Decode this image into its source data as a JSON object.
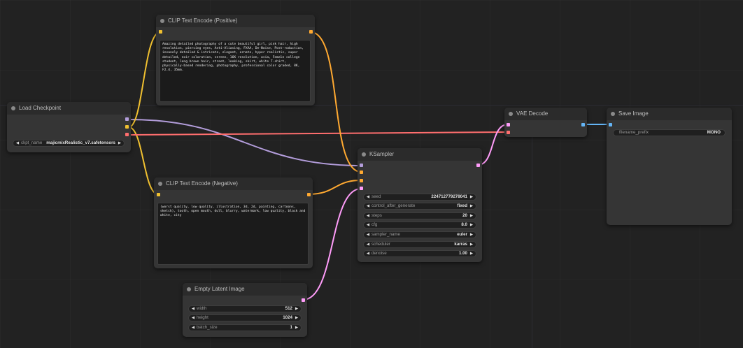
{
  "colors": {
    "background": "#222222",
    "node_body": "#353535",
    "node_title": "#2b2b2b",
    "model_link": "#b39ddb",
    "clip_link": "#f0c030",
    "vae_link": "#ff6e6e",
    "conditioning_link": "#ffa931",
    "latent_link": "#ff9cf9",
    "image_link": "#64b5f6"
  },
  "nodes": {
    "load_checkpoint": {
      "title": "Load Checkpoint",
      "ckpt_name_label": "ckpt_name",
      "ckpt_name_value": "majicmixRealistic_v7.safetensors"
    },
    "clip_positive": {
      "title": "CLIP Text Encode (Positive)",
      "text": "Amazing detailed photography of a cute beautiful girl, pink hair, high resolution, piercing eyes, Anti-Aliasing, FXAA, De-Noise, Post-roduction, insanely detailed & intricate, elegant, ornate, hyper realistic, super detailed, noir coloration, serene, 16K resolution, asia, Female college student, long brown hair, street, looking, skirt, white T-shirt, physically-based rendering, photography, professional color graded, 8K, F2.4, 35mm."
    },
    "clip_negative": {
      "title": "CLIP Text Encode (Negative)",
      "text": "(worst quality, low quality, illustration, 3d, 2d, painting, cartoons, sketch), tooth, open mouth, dull, blurry, watermark, low quality, black and white, city"
    },
    "empty_latent": {
      "title": "Empty Latent Image",
      "widgets": [
        {
          "label": "width",
          "value": "512"
        },
        {
          "label": "height",
          "value": "1024"
        },
        {
          "label": "batch_size",
          "value": "1"
        }
      ]
    },
    "ksampler": {
      "title": "KSampler",
      "widgets": [
        {
          "label": "seed",
          "value": "224712779278041"
        },
        {
          "label": "control_after_generate",
          "value": "fixed"
        },
        {
          "label": "steps",
          "value": "20"
        },
        {
          "label": "cfg",
          "value": "8.0"
        },
        {
          "label": "sampler_name",
          "value": "euler"
        },
        {
          "label": "scheduler",
          "value": "karras"
        },
        {
          "label": "denoise",
          "value": "1.00"
        }
      ]
    },
    "vae_decode": {
      "title": "VAE Decode"
    },
    "save_image": {
      "title": "Save Image",
      "filename_prefix_label": "filename_prefix",
      "filename_prefix_value": "MONO"
    }
  },
  "icons": {
    "arrow_left": "◀",
    "arrow_right": "▶"
  }
}
